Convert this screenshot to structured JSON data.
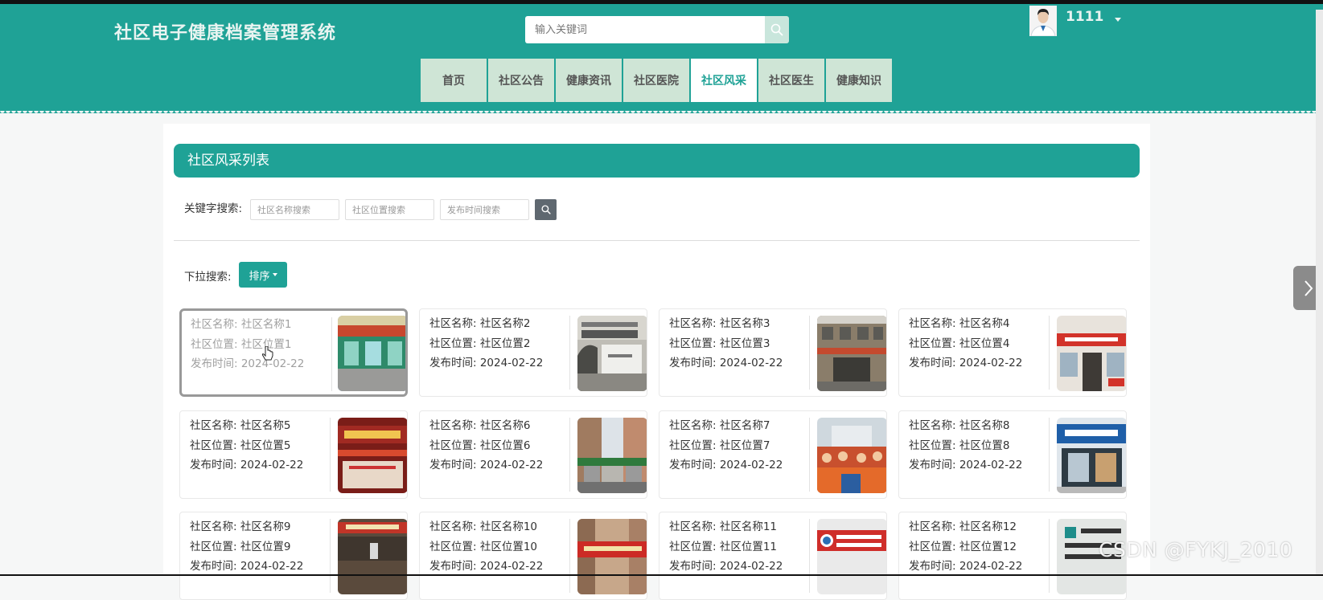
{
  "app": {
    "title": "社区电子健康档案管理系统"
  },
  "search": {
    "placeholder": "输入关键词",
    "value": ""
  },
  "user": {
    "name": "1111"
  },
  "nav": {
    "items": [
      {
        "label": "首页"
      },
      {
        "label": "社区公告"
      },
      {
        "label": "健康资讯"
      },
      {
        "label": "社区医院"
      },
      {
        "label": "社区风采",
        "active": true
      },
      {
        "label": "社区医生"
      },
      {
        "label": "健康知识"
      }
    ]
  },
  "list": {
    "title": "社区风采列表",
    "keyword_label": "关键字搜索:",
    "filters": [
      {
        "placeholder": "社区名称搜索"
      },
      {
        "placeholder": "社区位置搜索"
      },
      {
        "placeholder": "发布时间搜索"
      }
    ],
    "dropdown_label": "下拉搜索:",
    "sort_label": "排序"
  },
  "cards": [
    {
      "name": "社区名称: 社区名称1",
      "location": "社区位置: 社区位置1",
      "time": "发布时间: 2024-02-22"
    },
    {
      "name": "社区名称: 社区名称2",
      "location": "社区位置: 社区位置2",
      "time": "发布时间: 2024-02-22"
    },
    {
      "name": "社区名称: 社区名称3",
      "location": "社区位置: 社区位置3",
      "time": "发布时间: 2024-02-22"
    },
    {
      "name": "社区名称: 社区名称4",
      "location": "社区位置: 社区位置4",
      "time": "发布时间: 2024-02-22"
    },
    {
      "name": "社区名称: 社区名称5",
      "location": "社区位置: 社区位置5",
      "time": "发布时间: 2024-02-22"
    },
    {
      "name": "社区名称: 社区名称6",
      "location": "社区位置: 社区位置6",
      "time": "发布时间: 2024-02-22"
    },
    {
      "name": "社区名称: 社区名称7",
      "location": "社区位置: 社区位置7",
      "time": "发布时间: 2024-02-22"
    },
    {
      "name": "社区名称: 社区名称8",
      "location": "社区位置: 社区位置8",
      "time": "发布时间: 2024-02-22"
    },
    {
      "name": "社区名称: 社区名称9",
      "location": "社区位置: 社区位置9",
      "time": "发布时间: 2024-02-22"
    },
    {
      "name": "社区名称: 社区名称10",
      "location": "社区位置: 社区位置10",
      "time": "发布时间: 2024-02-22"
    },
    {
      "name": "社区名称: 社区名称11",
      "location": "社区位置: 社区位置11",
      "time": "发布时间: 2024-02-22"
    },
    {
      "name": "社区名称: 社区名称12",
      "location": "社区位置: 社区位置12",
      "time": "发布时间: 2024-02-22"
    }
  ],
  "watermark": "CSDN @FYKJ_2010",
  "colors": {
    "primary": "#1fa296",
    "nav_bg": "#cfe5d6",
    "search_btn": "#5f6870"
  },
  "icons": {
    "search": "search-icon",
    "next": "chevron-right-icon",
    "caret": "caret-down-icon"
  }
}
